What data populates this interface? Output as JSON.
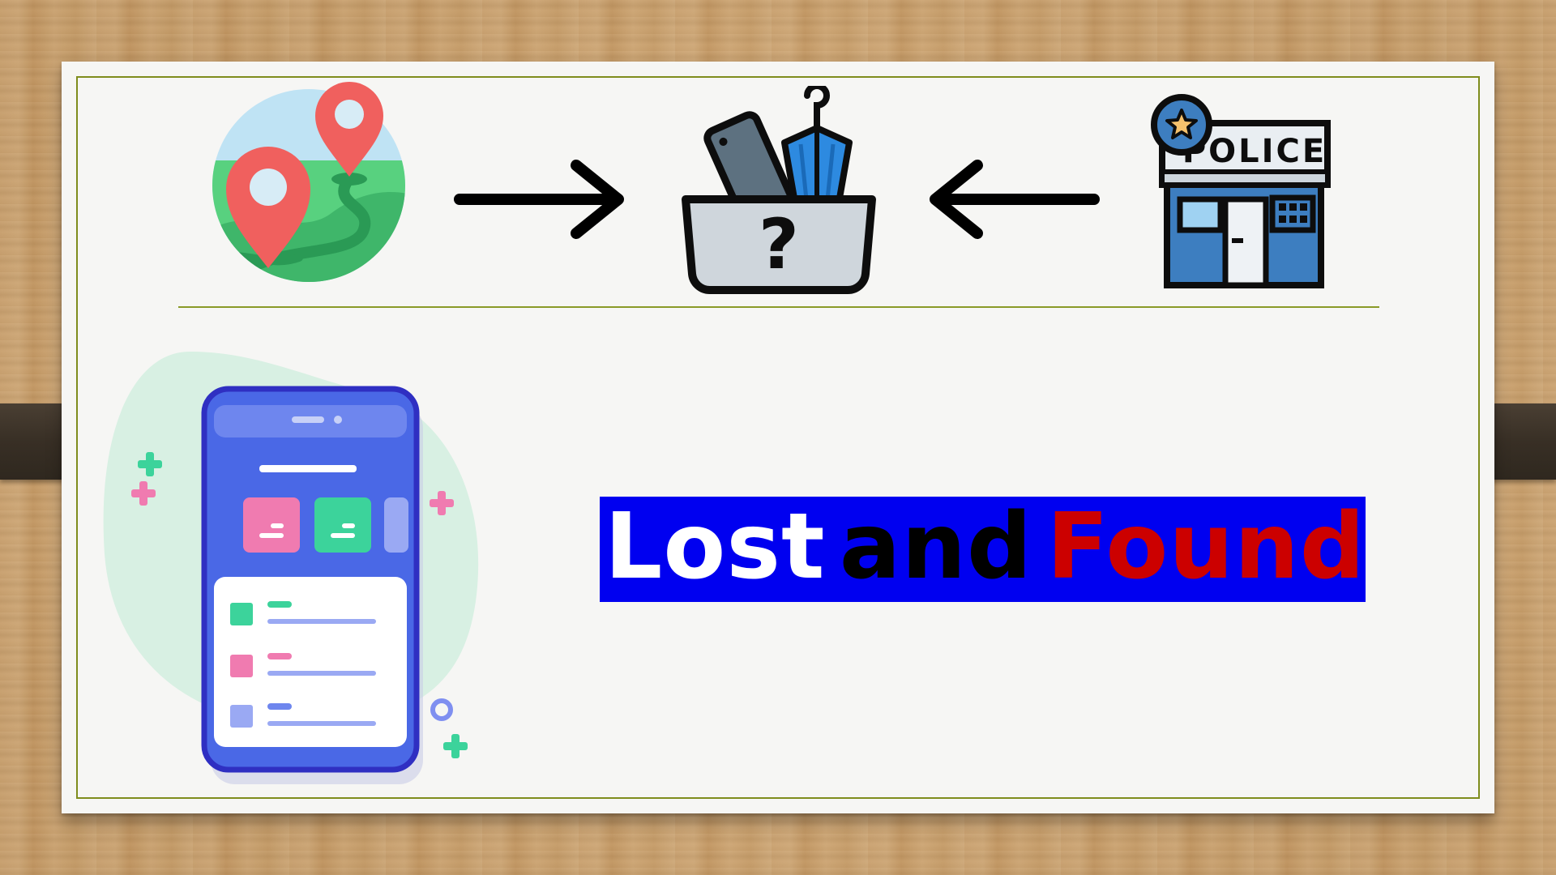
{
  "slide": {
    "title_words": [
      {
        "text": "Lost",
        "color": "#ffffff"
      },
      {
        "text": "and",
        "color": "#000000"
      },
      {
        "text": "Found",
        "color": "#cc0000"
      }
    ],
    "title_background": "#0000f0",
    "police_sign": "POLICE",
    "basket_symbol": "?"
  },
  "icons": {
    "location": "map-pin-icon",
    "arrow_right": "arrow-right-icon",
    "lost_items": "lost-items-basket-icon",
    "arrow_left": "arrow-left-icon",
    "police": "police-station-icon",
    "phone": "mobile-app-icon"
  }
}
